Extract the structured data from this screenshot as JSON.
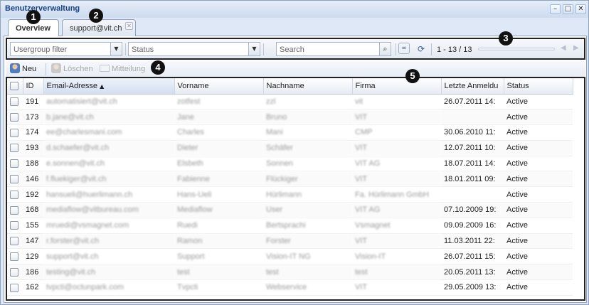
{
  "window": {
    "title": "Benutzerverwaltung",
    "controls": [
      "minimize-icon",
      "maximize-icon",
      "close-icon"
    ]
  },
  "tabs": [
    {
      "label": "Overview",
      "active": true
    },
    {
      "label": "support@vit.ch",
      "active": false,
      "closable": true
    }
  ],
  "filters": {
    "usergroup_placeholder": "Usergroup filter",
    "status_placeholder": "Status",
    "search_placeholder": "Search"
  },
  "paging": {
    "display": "1 - 13 / 13"
  },
  "actions": {
    "new": "Neu",
    "delete": "Löschen",
    "message": "Mitteilung"
  },
  "markers": [
    "1",
    "2",
    "3",
    "4",
    "5"
  ],
  "grid": {
    "columns": [
      "ID",
      "Email-Adresse",
      "Vorname",
      "Nachname",
      "Firma",
      "Letzte Anmeldu",
      "Status"
    ],
    "sorted_column": "Email-Adresse",
    "rows": [
      {
        "id": "191",
        "email": "automatisiert@vit.ch",
        "first": "zotfest",
        "last": "zzl",
        "firm": "vit",
        "last_login": "26.07.2011 14:",
        "status": "Active"
      },
      {
        "id": "173",
        "email": "b.jane@vit.ch",
        "first": "Jane",
        "last": "Bruno",
        "firm": "VIT",
        "last_login": "",
        "status": "Active"
      },
      {
        "id": "174",
        "email": "ee@charlesmani.com",
        "first": "Charles",
        "last": "Mani",
        "firm": "CMP",
        "last_login": "30.06.2010 11:",
        "status": "Active"
      },
      {
        "id": "193",
        "email": "d.schaefer@vit.ch",
        "first": "Dieter",
        "last": "Schäfer",
        "firm": "VIT",
        "last_login": "12.07.2011 10:",
        "status": "Active"
      },
      {
        "id": "188",
        "email": "e.sonnen@vit.ch",
        "first": "Elsbeth",
        "last": "Sonnen",
        "firm": "VIT AG",
        "last_login": "18.07.2011 14:",
        "status": "Active"
      },
      {
        "id": "146",
        "email": "f.fluekiger@vit.ch",
        "first": "Fabienne",
        "last": "Flückiger",
        "firm": "VIT",
        "last_login": "18.01.2011 09:",
        "status": "Active"
      },
      {
        "id": "192",
        "email": "hansueli@huerlimann.ch",
        "first": "Hans-Ueli",
        "last": "Hürlimann",
        "firm": "Fa. Hürlimann GmbH",
        "last_login": "",
        "status": "Active"
      },
      {
        "id": "168",
        "email": "mediaflow@vitbureau.com",
        "first": "Mediaflow",
        "last": "User",
        "firm": "VIT AG",
        "last_login": "07.10.2009 19:",
        "status": "Active"
      },
      {
        "id": "155",
        "email": "mruedi@vsmagnet.com",
        "first": "Ruedi",
        "last": "Bertsprachi",
        "firm": "Vsmagnet",
        "last_login": "09.09.2009 16:",
        "status": "Active"
      },
      {
        "id": "147",
        "email": "r.forster@vit.ch",
        "first": "Ramon",
        "last": "Forster",
        "firm": "VIT",
        "last_login": "11.03.2011 22:",
        "status": "Active"
      },
      {
        "id": "129",
        "email": "support@vit.ch",
        "first": "Support",
        "last": "Vision-IT NG",
        "firm": "Vision-IT",
        "last_login": "26.07.2011 15:",
        "status": "Active"
      },
      {
        "id": "186",
        "email": "testing@vit.ch",
        "first": "test",
        "last": "test",
        "firm": "test",
        "last_login": "20.05.2011 13:",
        "status": "Active"
      },
      {
        "id": "162",
        "email": "tvpcti@octunpark.com",
        "first": "Tvpcti",
        "last": "Webservice",
        "firm": "VIT",
        "last_login": "29.05.2009 13:",
        "status": "Active"
      }
    ]
  },
  "colors": {
    "title": "#15428b",
    "frame": "#8fa3bf",
    "marker": "#111111"
  }
}
